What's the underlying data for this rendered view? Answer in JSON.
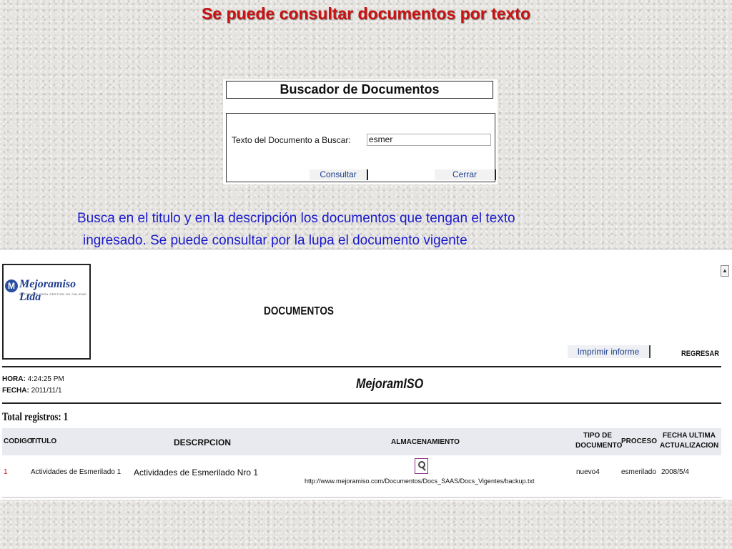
{
  "slide": {
    "title": "Se puede consultar documentos por texto",
    "description_line1": "Busca en el titulo y en la descripción los documentos que tengan el texto",
    "description_line2": "ingresado. Se puede consultar por la lupa el documento vigente"
  },
  "search_dialog": {
    "header": "Buscador de Documentos",
    "label": "Texto del Documento a Buscar:",
    "input_value": "esmer",
    "consultar_label": "Consultar",
    "cerrar_label": "Cerrar"
  },
  "documents": {
    "logo_text": "Mejoramiso Ltda",
    "logo_subtext": "SOFTWARE PARA GESTIÓN DE CALIDAD",
    "title": "DOCUMENTOS",
    "print_button": "Imprimir informe",
    "back_link": "REGRESAR",
    "hora_label": "HORA:",
    "hora_value": "4:24:25 PM",
    "fecha_label": "FECHA:",
    "fecha_value": "2011/11/1",
    "brand": "MejoramISO",
    "total_label": "Total registros: 1",
    "columns": {
      "codigo": "CODIGO",
      "titulo": "TITULO",
      "descripcion": "DESCRPCION",
      "almacenamiento": "ALMACENAMIENTO",
      "tipo_line1": "TIPO DE",
      "tipo_line2": "DOCUMENTO",
      "proceso": "PROCESO",
      "fecha_line1": "FECHA ULTIMA",
      "fecha_line2": "ACTUALIZACION"
    },
    "rows": [
      {
        "codigo": "1",
        "titulo": "Actividades de Esmerilado 1",
        "descripcion": "Actividades de Esmerilado Nro 1",
        "almacenamiento_url": "http://www.mejoramiso.com/Documentos/Docs_SAAS/Docs_Vigentes/backup.txt",
        "tipo": "nuevo4",
        "proceso": "esmerilado",
        "fecha": "2008/5/4"
      }
    ]
  }
}
